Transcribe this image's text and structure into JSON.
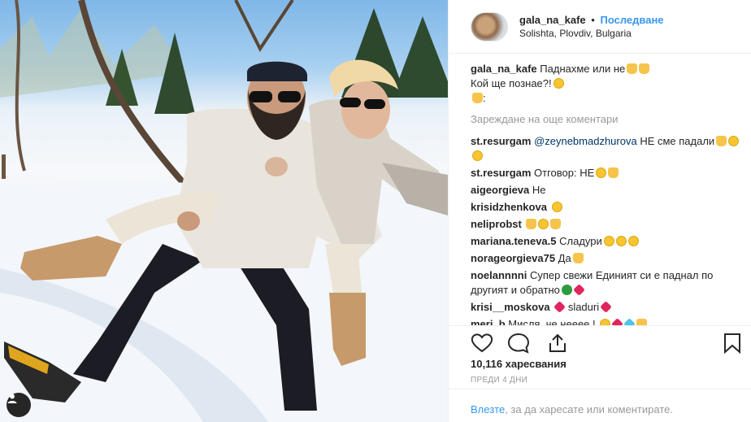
{
  "header": {
    "username": "gala_na_kafe",
    "separator": "•",
    "follow_label": "Последване",
    "location": "Solishta, Plovdiv, Bulgaria"
  },
  "caption": {
    "username": "gala_na_kafe",
    "line1": "Паднахме или не",
    "line2": "Кой ще познае?!",
    "line3": ":"
  },
  "load_more": "Зареждане на още коментари",
  "comments": [
    {
      "user": "st.resurgam",
      "mention": "@zeynebmadzhurova",
      "text": " НЕ сме падали"
    },
    {
      "user": "st.resurgam",
      "mention": "",
      "text": " Отговор: НЕ"
    },
    {
      "user": "aigeorgieva",
      "mention": "",
      "text": " Не"
    },
    {
      "user": "krisidzhenkova",
      "mention": "",
      "text": ""
    },
    {
      "user": "neliprobst",
      "mention": "",
      "text": ""
    },
    {
      "user": "mariana.teneva.5",
      "mention": "",
      "text": " Сладури"
    },
    {
      "user": "norageorgieva75",
      "mention": "",
      "text": " Да"
    },
    {
      "user": "noelannnni",
      "mention": "",
      "text": " Супер свежи  Единият си е паднал по другият и обратно"
    },
    {
      "user": "krisi__moskova",
      "mention": "",
      "text": " sladuri"
    },
    {
      "user": "meri_b",
      "mention": "",
      "text": " Мисля, че нееее !"
    }
  ],
  "likes": "10,116 харесвания",
  "time_ago": "ПРЕДИ 4 ДНИ",
  "login": {
    "link": "Влезте",
    "text": ", за да харесате или коментирате."
  },
  "icons": [
    "heart-icon",
    "comment-icon",
    "share-icon",
    "bookmark-icon",
    "user-icon"
  ],
  "colors": {
    "link": "#3897f0",
    "muted": "#999999",
    "text": "#262626"
  }
}
